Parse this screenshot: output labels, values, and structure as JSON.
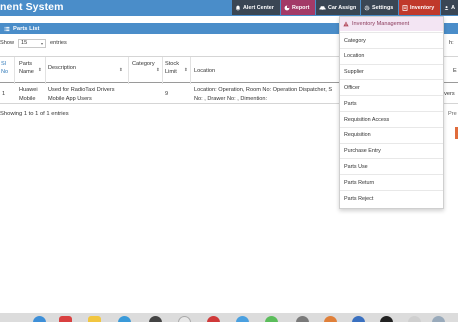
{
  "header": {
    "app_title": "nent System",
    "nav": {
      "alert_center": "Alert Center",
      "report": "Report",
      "car_assign": "Car Assign",
      "settings": "Settings",
      "inventory": "Inventory",
      "extra": "A"
    }
  },
  "panel": {
    "title": "Parts List"
  },
  "controls": {
    "show_label": "Show",
    "page_size": "15",
    "entries_label": "entries",
    "search_label": "h:"
  },
  "table": {
    "columns": {
      "sl": [
        "Sl",
        "No"
      ],
      "parts_name": [
        "Parts",
        "Name"
      ],
      "description": "Description",
      "category": "Category",
      "stock_limit": [
        "Stock",
        "Limit"
      ],
      "location": "Location",
      "more": "r",
      "edge": "E"
    },
    "rows": [
      {
        "sl": "1",
        "parts_name": [
          "Huawei",
          "Mobile"
        ],
        "description": [
          "Used for RadioTaxi Drivers",
          "Mobile App Users"
        ],
        "category": "",
        "stock_limit": "9",
        "location": [
          "Location: Operation, Room No: Operation Dispatcher, S",
          "No: , Drawer No: , Dimention:"
        ],
        "more": "rivers"
      }
    ]
  },
  "footer": {
    "info": "Showing 1 to 1 of 1 entries",
    "prev": "Pre"
  },
  "inventory_menu": {
    "header": "Inventory Management",
    "items": [
      "Category",
      "Location",
      "Supplier",
      "Officer",
      "Parts",
      "Requisition Access",
      "Requisition",
      "Purchase Entry",
      "Parts Use",
      "Parts Return",
      "Parts Reject"
    ]
  },
  "colors": {
    "header_blue": "#4a8dc9",
    "inventory_red": "#c0392b",
    "report_magenta": "#a33a67",
    "dark_nav": "#3a4654"
  }
}
